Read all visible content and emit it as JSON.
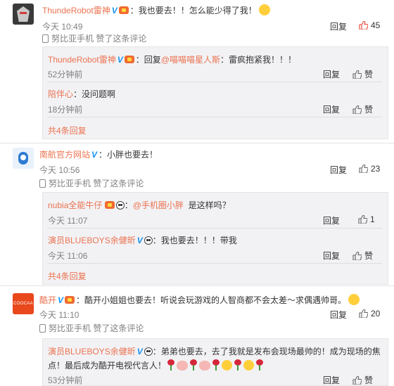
{
  "comments": [
    {
      "user": "ThundeRobot雷神",
      "text": "：我也要去！！怎么能少得了我！",
      "time": "今天 10:49",
      "device": "努比亚手机 赞了这条评论",
      "reply_label": "回复",
      "likes": "45",
      "replies": [
        {
          "user": "ThundeRobot雷神",
          "text_prefix": "：回复",
          "mention": "@喵喵喵星人斯",
          "text": "：雷疯抱紧我！！！",
          "time": "52分钟前",
          "reply_label": "回复",
          "like_label": "赞"
        },
        {
          "user": "陪伴心",
          "text": "：没问题啊",
          "time": "18分钟前",
          "reply_label": "回复",
          "like_label": "赞"
        }
      ],
      "more": "共4条回复"
    },
    {
      "user": "南航官方网站",
      "text": "：小胖也要去！",
      "time": "今天 10:56",
      "device": "努比亚手机 赞了这条评论",
      "reply_label": "回复",
      "likes": "23",
      "replies": [
        {
          "user": "nubia全能牛仔",
          "mention": "@手机圈小胖",
          "text": "是这样吗？",
          "time": "今天 11:07",
          "reply_label": "回复",
          "likes": "1"
        },
        {
          "user": "演员BLUEBOYS余健昕",
          "text": "：我也要去！！！带我",
          "time": "今天 11:06",
          "reply_label": "回复",
          "like_label": "赞"
        }
      ],
      "more": "共4条回复"
    },
    {
      "user": "酷开",
      "avatar_text": "COOCAA 酷开",
      "text": "：酷开小姐姐也要去！听说会玩游戏的人智商都不会太差～求偶遇帅哥。",
      "time": "今天 11:10",
      "device": "努比亚手机 赞了这条评论",
      "reply_label": "回复",
      "likes": "20",
      "replies": [
        {
          "user": "演员BLUEBOYS余健昕",
          "text_line1": "：弟弟也要去，去了我就是发布会现场最帅的！成为现场的焦",
          "text_line2": "点！最后成为酷开电视代言人！",
          "time": "53分钟前",
          "reply_label": "回复",
          "like_label": "赞"
        }
      ]
    }
  ],
  "colors": {
    "username": "#eb7350",
    "verified": "#1a93f0",
    "liked": "#e8452f"
  }
}
